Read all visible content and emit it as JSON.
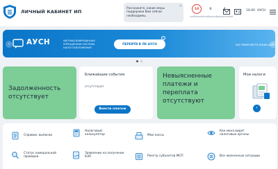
{
  "header": {
    "brand": "ЛИЧНЫЙ КАБИНЕТ ИП",
    "assistant_text": "Расскажите, какие меры поддержки Вам сейчас необходимы.",
    "counters": [
      {
        "value": "10",
        "label": "требований"
      },
      {
        "value": "0",
        "label": "сообщений"
      },
      {
        "value": "4",
        "label": "уведомлений"
      }
    ],
    "time_label": "16:00",
    "ausn_label": "АУСН"
  },
  "banner": {
    "title": "АУСН",
    "description": "АВТОМАТИЗИРОВАННАЯ УПРОЩЁННАЯ СИСТЕМА НАЛОГООБЛОЖЕНИЯ",
    "button_label": "ПЕРЕЙТИ В ЛК АУСН",
    "info_glyph": "i",
    "link_label": "КАК ПРИМЕНЯЕТСЯ РЕЖИМ АУСН",
    "prev_glyph": "‹",
    "next_glyph": "›"
  },
  "cards": {
    "debt_title": "Задолженность отсутствует",
    "events_title": "Ближайшие события",
    "events_status": "отсутствуют",
    "pay_button": "Внести платеж",
    "unclear_title": "Невыясненные платежи и переплата отсутствуют",
    "taxes_title": "Мои налоги",
    "taxes_arrow": "›"
  },
  "services": [
    {
      "label": "Справки, выписки",
      "icon": "document-icon"
    },
    {
      "label": "Налоговый калькулятор",
      "icon": "calculator-icon"
    },
    {
      "label": "Мои кассы",
      "icon": "cash-register-icon"
    },
    {
      "label": "Как меня видят налоговые органы",
      "icon": "eye-icon"
    },
    {
      "label": "Статус камеральной проверки",
      "icon": "magnifier-icon"
    },
    {
      "label": "Заявление на получение КЭП",
      "icon": "signature-icon"
    },
    {
      "label": "Реестр субъектов МСП",
      "icon": "registry-icon"
    },
    {
      "label": "Все жизненные ситуации",
      "icon": "list-icon"
    }
  ],
  "colors": {
    "accent": "#0b75c7",
    "green_card": "#7ccd96",
    "alert": "#e3413b"
  }
}
